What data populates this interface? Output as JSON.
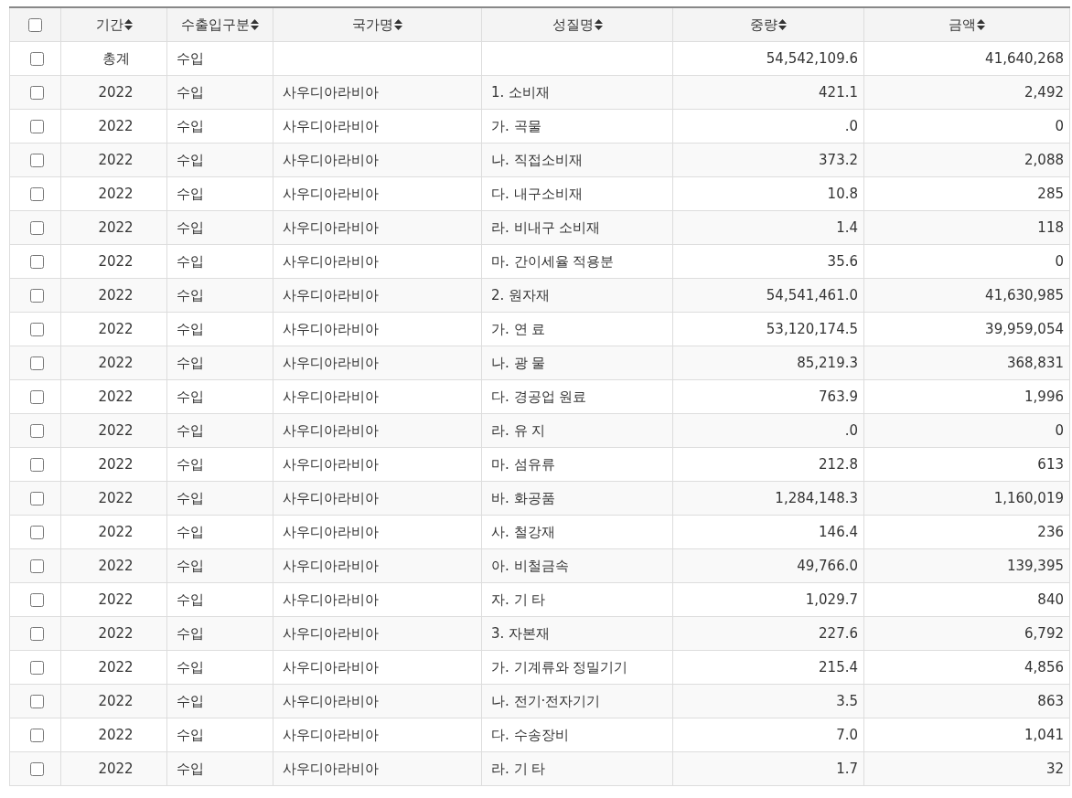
{
  "table": {
    "select_all": {
      "checked": false
    },
    "columns": [
      "기간",
      "수출입구분",
      "국가명",
      "성질명",
      "중량",
      "금액"
    ],
    "rows": [
      {
        "checked": false,
        "cells": [
          "총계",
          "수입",
          "",
          "",
          "54,542,109.6",
          "41,640,268"
        ]
      },
      {
        "checked": false,
        "cells": [
          "2022",
          "수입",
          "사우디아라비아",
          "1. 소비재",
          "421.1",
          "2,492"
        ]
      },
      {
        "checked": false,
        "cells": [
          "2022",
          "수입",
          "사우디아라비아",
          "가. 곡물",
          ".0",
          "0"
        ]
      },
      {
        "checked": false,
        "cells": [
          "2022",
          "수입",
          "사우디아라비아",
          "나. 직접소비재",
          "373.2",
          "2,088"
        ]
      },
      {
        "checked": false,
        "cells": [
          "2022",
          "수입",
          "사우디아라비아",
          "다. 내구소비재",
          "10.8",
          "285"
        ]
      },
      {
        "checked": false,
        "cells": [
          "2022",
          "수입",
          "사우디아라비아",
          "라. 비내구 소비재",
          "1.4",
          "118"
        ]
      },
      {
        "checked": false,
        "cells": [
          "2022",
          "수입",
          "사우디아라비아",
          "마. 간이세율 적용분",
          "35.6",
          "0"
        ]
      },
      {
        "checked": false,
        "cells": [
          "2022",
          "수입",
          "사우디아라비아",
          "2. 원자재",
          "54,541,461.0",
          "41,630,985"
        ]
      },
      {
        "checked": false,
        "cells": [
          "2022",
          "수입",
          "사우디아라비아",
          "가. 연 료",
          "53,120,174.5",
          "39,959,054"
        ]
      },
      {
        "checked": false,
        "cells": [
          "2022",
          "수입",
          "사우디아라비아",
          "나. 광 물",
          "85,219.3",
          "368,831"
        ]
      },
      {
        "checked": false,
        "cells": [
          "2022",
          "수입",
          "사우디아라비아",
          "다. 경공업 원료",
          "763.9",
          "1,996"
        ]
      },
      {
        "checked": false,
        "cells": [
          "2022",
          "수입",
          "사우디아라비아",
          "라. 유 지",
          ".0",
          "0"
        ]
      },
      {
        "checked": false,
        "cells": [
          "2022",
          "수입",
          "사우디아라비아",
          "마. 섬유류",
          "212.8",
          "613"
        ]
      },
      {
        "checked": false,
        "cells": [
          "2022",
          "수입",
          "사우디아라비아",
          "바. 화공품",
          "1,284,148.3",
          "1,160,019"
        ]
      },
      {
        "checked": false,
        "cells": [
          "2022",
          "수입",
          "사우디아라비아",
          "사. 철강재",
          "146.4",
          "236"
        ]
      },
      {
        "checked": false,
        "cells": [
          "2022",
          "수입",
          "사우디아라비아",
          "아. 비철금속",
          "49,766.0",
          "139,395"
        ]
      },
      {
        "checked": false,
        "cells": [
          "2022",
          "수입",
          "사우디아라비아",
          "자. 기 타",
          "1,029.7",
          "840"
        ]
      },
      {
        "checked": false,
        "cells": [
          "2022",
          "수입",
          "사우디아라비아",
          "3. 자본재",
          "227.6",
          "6,792"
        ]
      },
      {
        "checked": false,
        "cells": [
          "2022",
          "수입",
          "사우디아라비아",
          "가. 기계류와 정밀기기",
          "215.4",
          "4,856"
        ]
      },
      {
        "checked": false,
        "cells": [
          "2022",
          "수입",
          "사우디아라비아",
          "나. 전기·전자기기",
          "3.5",
          "863"
        ]
      },
      {
        "checked": false,
        "cells": [
          "2022",
          "수입",
          "사우디아라비아",
          "다. 수송장비",
          "7.0",
          "1,041"
        ]
      },
      {
        "checked": false,
        "cells": [
          "2022",
          "수입",
          "사우디아라비아",
          "라. 기 타",
          "1.7",
          "32"
        ]
      }
    ]
  }
}
